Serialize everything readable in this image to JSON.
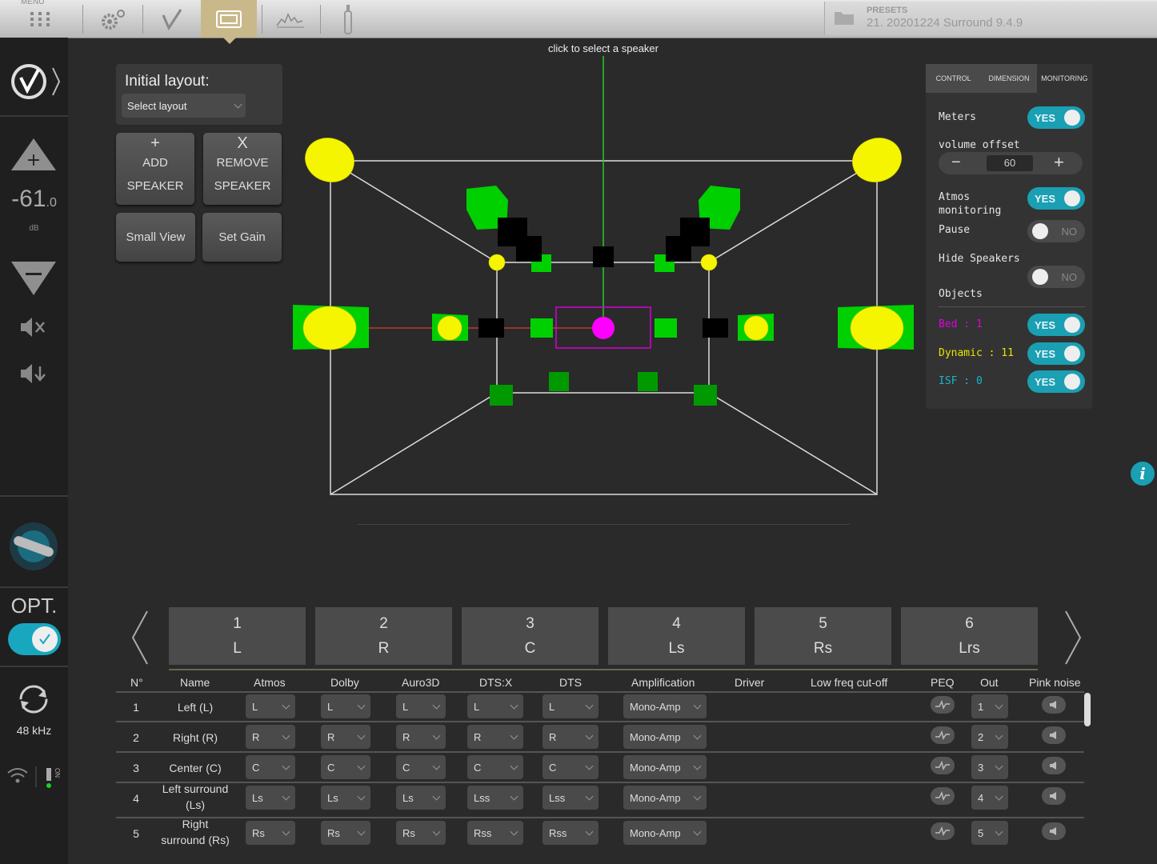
{
  "topbar": {
    "menu_label": "MENU",
    "presets_label": "PRESETS",
    "preset_value": "21. 20201224 Surround 9.4.9"
  },
  "sidebar": {
    "volume_int": "-61",
    "volume_dec": ".0",
    "volume_unit": "dB",
    "opt_label": "OPT.",
    "sample_rate": "48 kHz",
    "on_label": "ON"
  },
  "layout_panel": {
    "title": "Initial layout:",
    "select_placeholder": "Select layout",
    "add_symbol": "+",
    "add_line1": "ADD",
    "add_line2": "SPEAKER",
    "remove_symbol": "X",
    "remove_line1": "REMOVE",
    "remove_line2": "SPEAKER",
    "small_view": "Small View",
    "set_gain": "Set Gain"
  },
  "viewport": {
    "hint": "click to select a speaker"
  },
  "right_panel": {
    "tabs": [
      "CONTROL",
      "DIMENSION",
      "MONITORING"
    ],
    "active_tab": "MONITORING",
    "meters_label": "Meters",
    "meters_value": "YES",
    "volume_offset_label": "volume offset",
    "volume_offset_value": "60",
    "minus": "−",
    "plus": "+",
    "atmos_label_1": "Atmos",
    "atmos_label_2": "monitoring",
    "atmos_value": "YES",
    "pause_label": "Pause",
    "pause_value": "NO",
    "hide_label": "Hide Speakers",
    "hide_value": "NO",
    "objects_label": "Objects",
    "bed_label": "Bed : 1",
    "bed_value": "YES",
    "dynamic_label": "Dynamic : 11",
    "dynamic_value": "YES",
    "isf_label": "ISF : 0",
    "isf_value": "YES",
    "colors": {
      "bed": "#e000e0",
      "dynamic": "#e6e600",
      "isf": "#19b6c8",
      "toggle_on": "#1a9fb3"
    }
  },
  "speaker_tabs": [
    {
      "num": "1",
      "label": "L"
    },
    {
      "num": "2",
      "label": "R"
    },
    {
      "num": "3",
      "label": "C"
    },
    {
      "num": "4",
      "label": "Ls"
    },
    {
      "num": "5",
      "label": "Rs"
    },
    {
      "num": "6",
      "label": "Lrs"
    }
  ],
  "table": {
    "headers": [
      "N°",
      "Name",
      "Atmos",
      "Dolby",
      "Auro3D",
      "DTS:X",
      "DTS",
      "Amplification",
      "Driver",
      "Low freq cut-off",
      "PEQ",
      "Out",
      "Pink noise"
    ],
    "rows": [
      {
        "n": "1",
        "name1": "Left (L)",
        "name2": "",
        "atmos": "L",
        "dolby": "L",
        "auro": "L",
        "dtsx": "L",
        "dts": "L",
        "amp": "Mono-Amp",
        "out": "1"
      },
      {
        "n": "2",
        "name1": "Right (R)",
        "name2": "",
        "atmos": "R",
        "dolby": "R",
        "auro": "R",
        "dtsx": "R",
        "dts": "R",
        "amp": "Mono-Amp",
        "out": "2"
      },
      {
        "n": "3",
        "name1": "Center (C)",
        "name2": "",
        "atmos": "C",
        "dolby": "C",
        "auro": "C",
        "dtsx": "C",
        "dts": "C",
        "amp": "Mono-Amp",
        "out": "3"
      },
      {
        "n": "4",
        "name1": "Left surround",
        "name2": "(Ls)",
        "atmos": "Ls",
        "dolby": "Ls",
        "auro": "Ls",
        "dtsx": "Lss",
        "dts": "Lss",
        "amp": "Mono-Amp",
        "out": "4"
      },
      {
        "n": "5",
        "name1": "Right",
        "name2": "surround (Rs)",
        "atmos": "Rs",
        "dolby": "Rs",
        "auro": "Rs",
        "dtsx": "Rss",
        "dts": "Rss",
        "amp": "Mono-Amp",
        "out": "5"
      }
    ]
  },
  "icons": [
    "menu-grid-icon",
    "settings-icon",
    "check-icon",
    "monitor-icon",
    "graph-icon",
    "microphone-icon",
    "folder-icon",
    "logo-icon",
    "volume-up-icon",
    "volume-down-icon",
    "mute-icon",
    "dim-icon",
    "mic-connector-icon",
    "sync-icon",
    "wifi-icon",
    "info-icon",
    "peq-icon",
    "speaker-icon"
  ]
}
